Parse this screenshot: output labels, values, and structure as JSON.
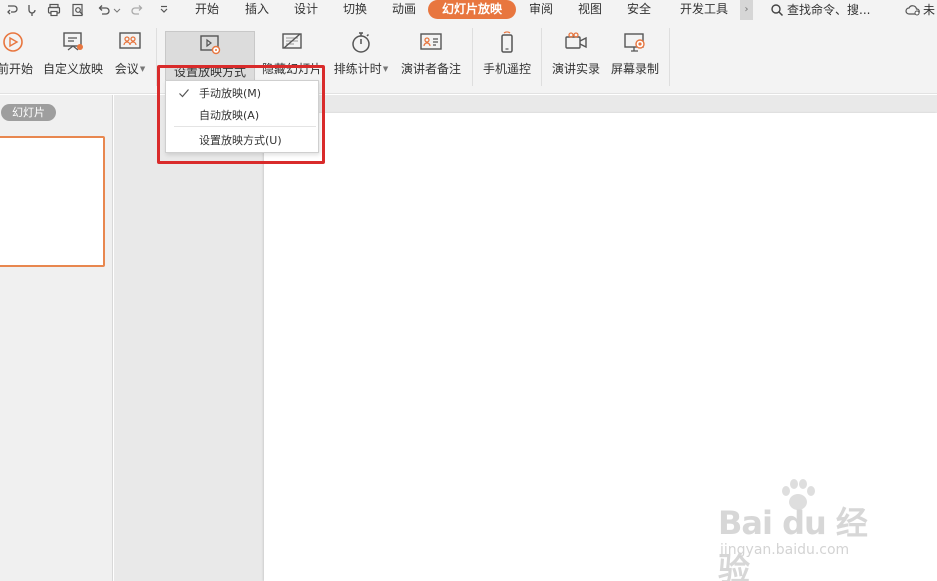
{
  "tabs": {
    "start": "开始",
    "insert": "插入",
    "design": "设计",
    "transition": "切换",
    "animation": "动画",
    "slideshow": "幻灯片放映",
    "review": "审阅",
    "view": "视图",
    "security": "安全",
    "developer": "开发工具",
    "more": "›",
    "search_label": "查找命令、搜...",
    "cloud_label": "未"
  },
  "ribbon": {
    "from_current": "前开始",
    "custom_show": "自定义放映",
    "meeting": "会议",
    "set_show_mode": "设置放映方式",
    "hide_slide": "隐藏幻灯片",
    "rehearse_timing": "排练计时",
    "presenter_notes": "演讲者备注",
    "phone_remote": "手机遥控",
    "record_live": "演讲实录",
    "screen_record": "屏幕录制"
  },
  "dropdown": {
    "manual": "手动放映(M)",
    "auto": "自动放映(A)",
    "settings": "设置放映方式(U)"
  },
  "left_pane": {
    "slides_tab": "幻灯片"
  },
  "watermark": {
    "logo": "Bai du 经验",
    "url": "jingyan.baidu.com"
  },
  "colors": {
    "accent": "#e8763f",
    "highlight": "#d92b2b",
    "thumb_border": "#e8874f"
  }
}
